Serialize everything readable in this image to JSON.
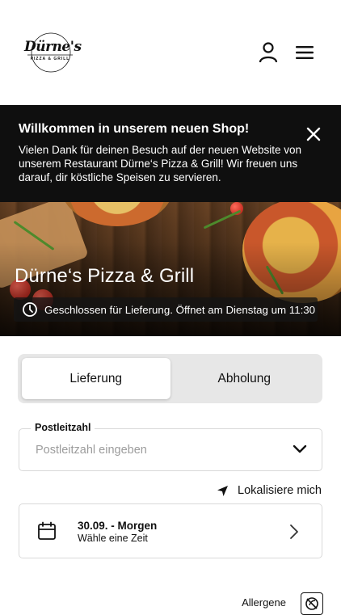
{
  "header": {
    "logo_name": "Dürne's",
    "logo_subtitle": "PIZZA & GRILL",
    "user_icon": "user-icon",
    "menu_icon": "hamburger-menu-icon"
  },
  "banner": {
    "title": "Willkommen in unserem neuen Shop!",
    "text": "Vielen Dank für deinen Besuch auf der neuen Website von unserem Restaurant Dürne‘s Pizza & Grill! Wir freuen uns darauf, dir köstliche Speisen zu servieren.",
    "close_icon": "close-icon"
  },
  "hero": {
    "restaurant_name": "Dürne‘s Pizza & Grill",
    "status": "Geschlossen für Lieferung. Öffnet am Dienstag um 11:30",
    "status_icon": "clock-icon"
  },
  "order_mode": {
    "options": [
      "Lieferung",
      "Abholung"
    ],
    "selected": "Lieferung"
  },
  "postal_code": {
    "label": "Postleitzahl",
    "placeholder": "Postleitzahl eingeben",
    "value": ""
  },
  "locate": {
    "label": "Lokalisiere mich",
    "icon": "location-arrow-icon"
  },
  "date": {
    "date_text": "30.09. - Morgen",
    "time_text": "Wähle eine Zeit",
    "icon": "calendar-icon"
  },
  "allergens": {
    "label": "Allergene",
    "icon": "allergen-icon"
  },
  "colors": {
    "banner_bg": "#0f0f0f",
    "segment_bg": "#e7e7e7",
    "border": "#d9d9d9",
    "text": "#111111"
  }
}
